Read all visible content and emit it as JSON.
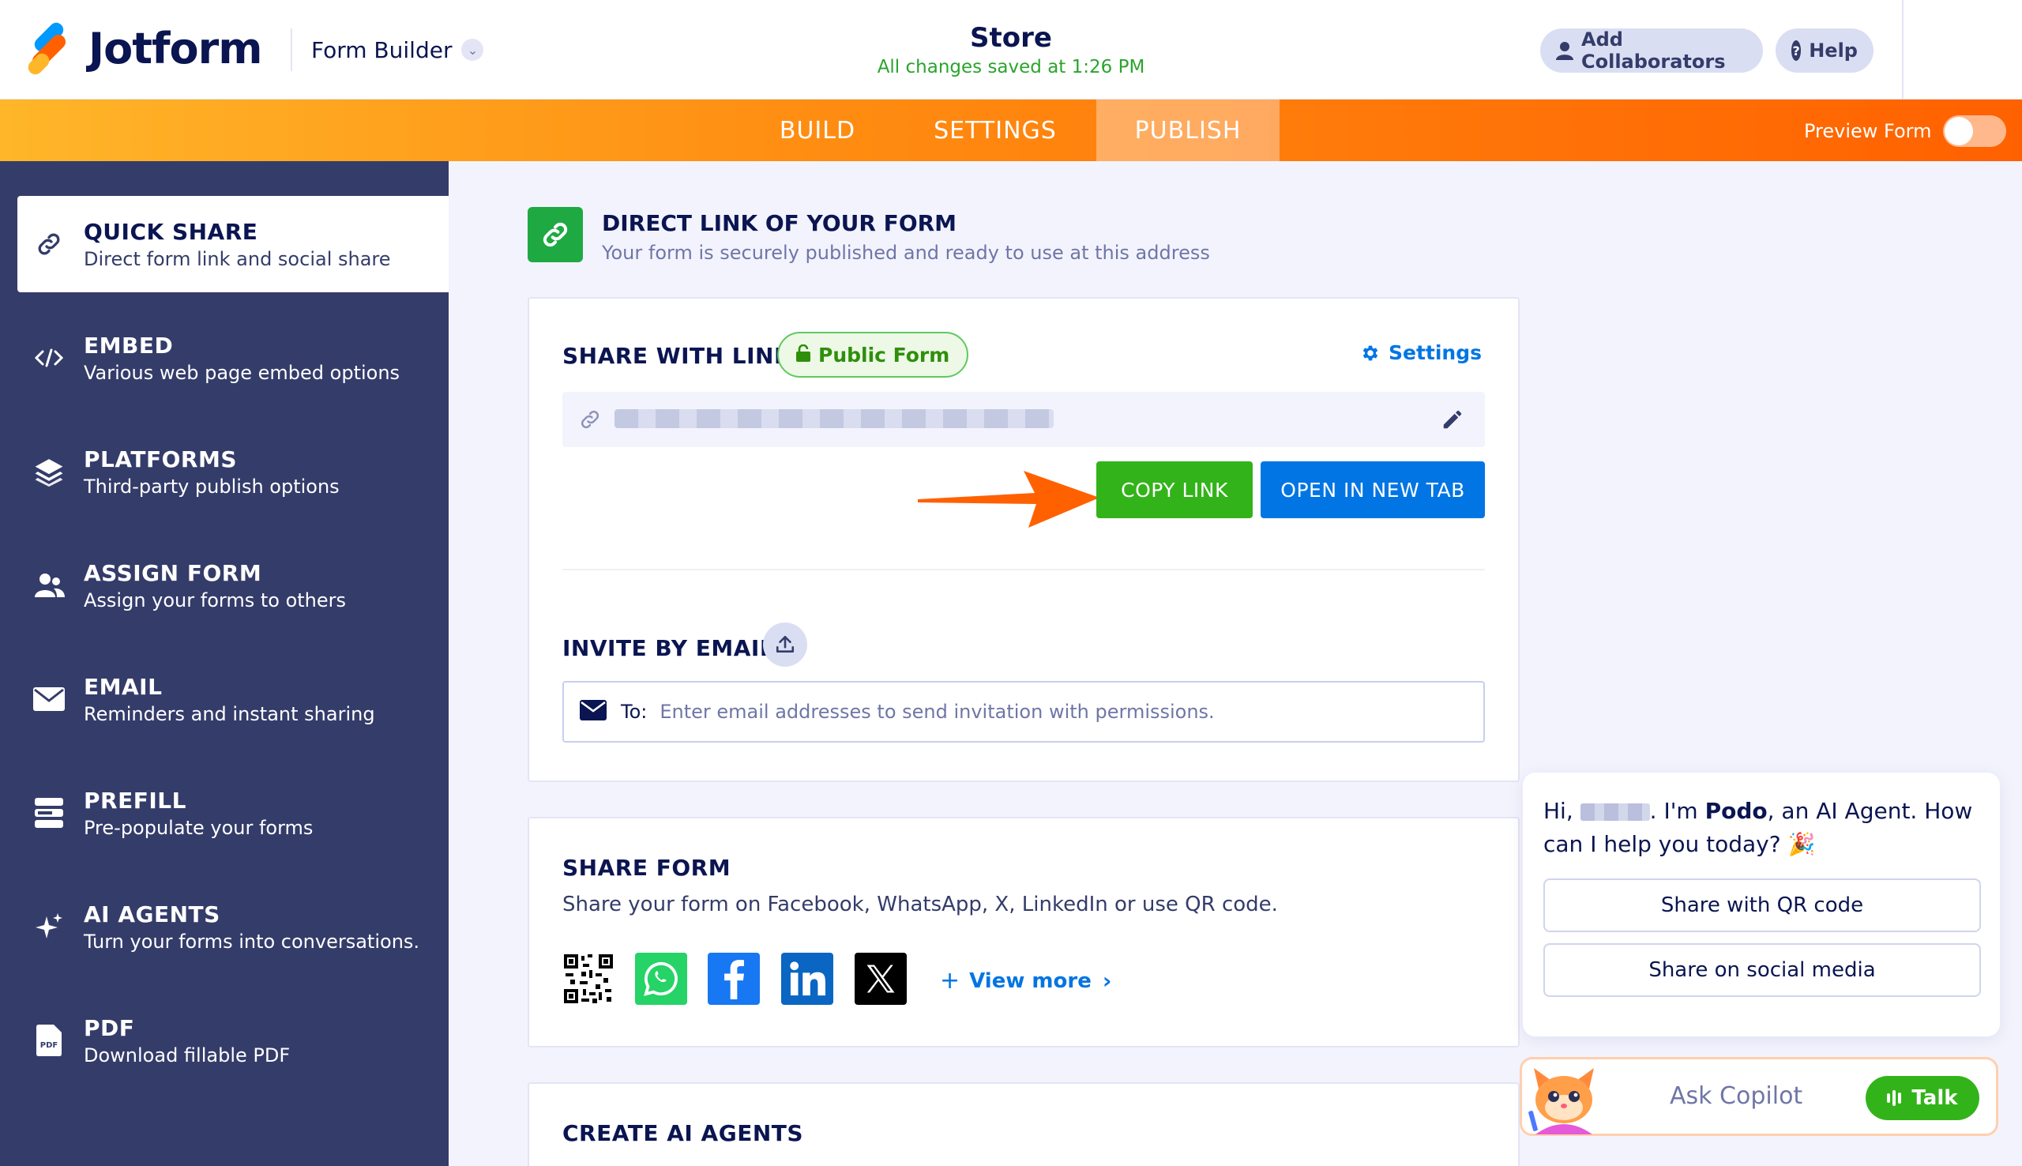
{
  "header": {
    "brand": "Jotform",
    "builder_label": "Form Builder",
    "form_title": "Store",
    "save_status": "All changes saved at 1:26 PM",
    "add_collaborators": "Add Collaborators",
    "help": "Help"
  },
  "nav": {
    "tabs": [
      {
        "label": "BUILD",
        "active": false
      },
      {
        "label": "SETTINGS",
        "active": false
      },
      {
        "label": "PUBLISH",
        "active": true
      }
    ],
    "preview_label": "Preview Form",
    "preview_on": false
  },
  "sidebar": {
    "items": [
      {
        "title": "QUICK SHARE",
        "subtitle": "Direct form link and social share",
        "icon": "link-icon",
        "active": true
      },
      {
        "title": "EMBED",
        "subtitle": "Various web page embed options",
        "icon": "code-icon",
        "active": false
      },
      {
        "title": "PLATFORMS",
        "subtitle": "Third-party publish options",
        "icon": "layers-icon",
        "active": false
      },
      {
        "title": "ASSIGN FORM",
        "subtitle": "Assign your forms to others",
        "icon": "users-icon",
        "active": false
      },
      {
        "title": "EMAIL",
        "subtitle": "Reminders and instant sharing",
        "icon": "envelope-icon",
        "active": false
      },
      {
        "title": "PREFILL",
        "subtitle": "Pre-populate your forms",
        "icon": "prefill-icon",
        "active": false
      },
      {
        "title": "AI AGENTS",
        "subtitle": "Turn your forms into conversations.",
        "icon": "sparkle-icon",
        "active": false
      },
      {
        "title": "PDF",
        "subtitle": "Download fillable PDF",
        "icon": "pdf-icon",
        "active": false
      }
    ]
  },
  "main": {
    "direct_link_title": "DIRECT LINK OF YOUR FORM",
    "direct_link_subtitle": "Your form is securely published and ready to use at this address",
    "share_with_link": "SHARE WITH LINK",
    "public_badge": "Public Form",
    "settings_label": "Settings",
    "copy_link": "COPY LINK",
    "open_new_tab": "OPEN IN NEW TAB",
    "invite_title": "INVITE BY EMAIL",
    "email_to": "To:",
    "email_placeholder": "Enter email addresses to send invitation with permissions.",
    "share_form_title": "SHARE FORM",
    "share_form_desc": "Share your form on Facebook, WhatsApp, X, LinkedIn or use QR code.",
    "social_icons": [
      "qr-code-icon",
      "whatsapp-icon",
      "facebook-icon",
      "linkedin-icon",
      "x-icon"
    ],
    "view_more": "View more",
    "create_ai_title": "CREATE AI AGENTS"
  },
  "copilot": {
    "greeting_prefix": "Hi,",
    "greeting_mid": ". I'm ",
    "agent_name": "Podo",
    "greeting_suffix": ", an AI Agent. How can I help you today? 🎉",
    "chips": [
      "Share with QR code",
      "Share on social media"
    ],
    "ask_placeholder": "Ask Copilot",
    "talk": "Talk"
  },
  "colors": {
    "accent_orange": "#ff6100",
    "success_green": "#33b31a",
    "primary_blue": "#0075e3",
    "navy": "#0a1551",
    "sidebar_bg": "#343c6a"
  }
}
